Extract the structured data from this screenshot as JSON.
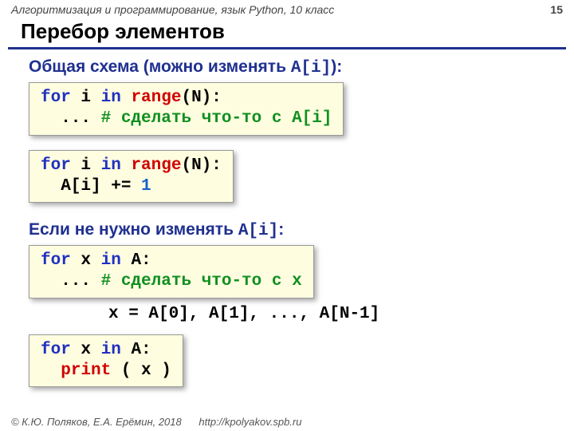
{
  "header": {
    "course": "Алгоритмизация и программирование, язык Python, 10 класс",
    "page": "15"
  },
  "title": "Перебор элементов",
  "section1": {
    "heading_plain": "Общая схема (можно изменять ",
    "heading_mono": "A[i]",
    "heading_close": "):"
  },
  "code1": {
    "l1_for": "for",
    "l1_i": " i ",
    "l1_in": "in",
    "l1_sp": " ",
    "l1_range": "range",
    "l1_rest": "(N):",
    "l2_indent": "  ... ",
    "l2_cmt": "# сделать что-то с A[i]"
  },
  "code2": {
    "l1_for": "for",
    "l1_i": " i ",
    "l1_in": "in",
    "l1_sp": " ",
    "l1_range": "range",
    "l1_rest": "(N):",
    "l2_indent": "  A[i] += ",
    "l2_num": "1"
  },
  "section2": {
    "heading_plain": "Если не нужно изменять ",
    "heading_mono": "A[i]",
    "heading_close": ":"
  },
  "code3": {
    "l1_for": "for",
    "l1_x": " x ",
    "l1_in": "in",
    "l1_rest": " A:",
    "l2_indent": "  ... ",
    "l2_cmt": "# сделать что-то с x"
  },
  "note": "x = A[0], A[1], ..., A[N-1]",
  "code4": {
    "l1_for": "for",
    "l1_x": " x ",
    "l1_in": "in",
    "l1_rest": " A:",
    "l2_indent": "  ",
    "l2_fn": "print",
    "l2_rest": " ( x )"
  },
  "footer": {
    "copyright": "© К.Ю. Поляков, Е.А. Ерёмин, 2018",
    "url": "http://kpolyakov.spb.ru"
  }
}
